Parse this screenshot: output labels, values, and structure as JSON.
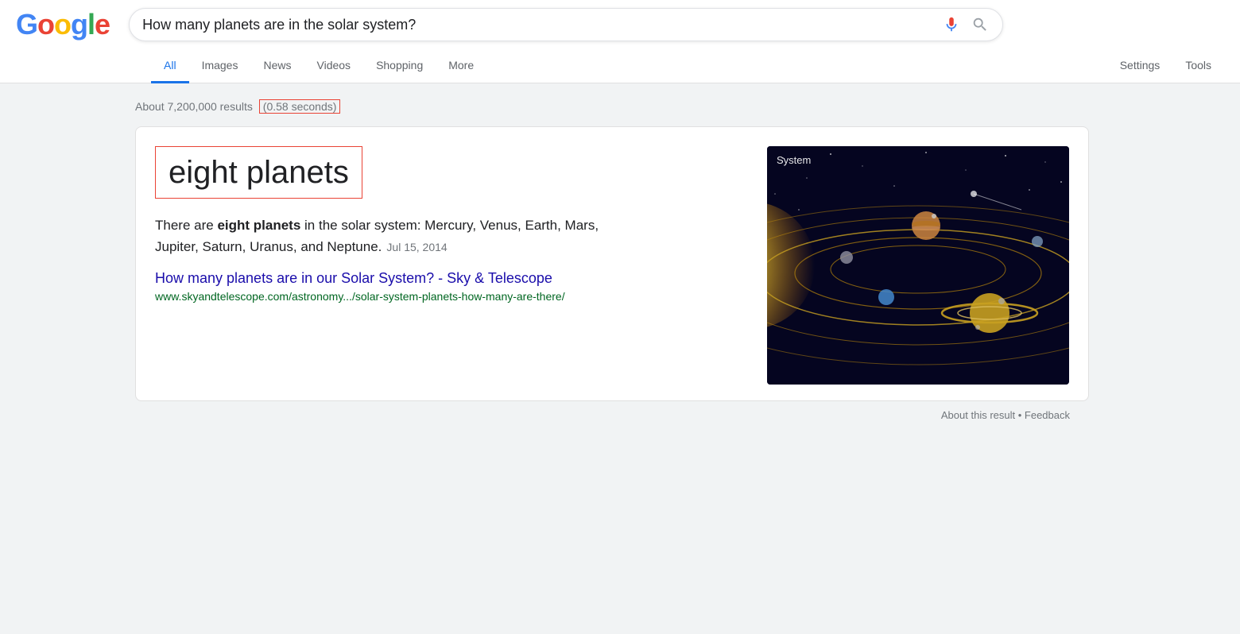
{
  "header": {
    "logo": {
      "letters": [
        {
          "char": "G",
          "color": "#4285F4"
        },
        {
          "char": "o",
          "color": "#EA4335"
        },
        {
          "char": "o",
          "color": "#FBBC05"
        },
        {
          "char": "g",
          "color": "#4285F4"
        },
        {
          "char": "l",
          "color": "#34A853"
        },
        {
          "char": "e",
          "color": "#EA4335"
        }
      ]
    },
    "search_query": "How many planets are in the solar system?",
    "search_placeholder": "Search"
  },
  "nav": {
    "tabs": [
      {
        "label": "All",
        "active": true
      },
      {
        "label": "Images",
        "active": false
      },
      {
        "label": "News",
        "active": false
      },
      {
        "label": "Videos",
        "active": false
      },
      {
        "label": "Shopping",
        "active": false
      },
      {
        "label": "More",
        "active": false
      }
    ],
    "right_tabs": [
      {
        "label": "Settings"
      },
      {
        "label": "Tools"
      }
    ]
  },
  "results": {
    "count_text": "About 7,200,000 results",
    "time_text": "(0.58 seconds)"
  },
  "snippet": {
    "answer": "eight planets",
    "description_before": "There are ",
    "description_bold": "eight planets",
    "description_after": " in the solar system: Mercury, Venus, Earth, Mars, Jupiter, Saturn, Uranus, and Neptune.",
    "date": "Jul 15, 2014",
    "link_text": "How many planets are in our Solar System? - Sky & Telescope",
    "url": "www.skyandtelescope.com/astronomy.../solar-system-planets-how-many-are-there/",
    "image_label": "System"
  },
  "footer": {
    "about_text": "About this result",
    "separator": "•",
    "feedback_text": "Feedback"
  }
}
